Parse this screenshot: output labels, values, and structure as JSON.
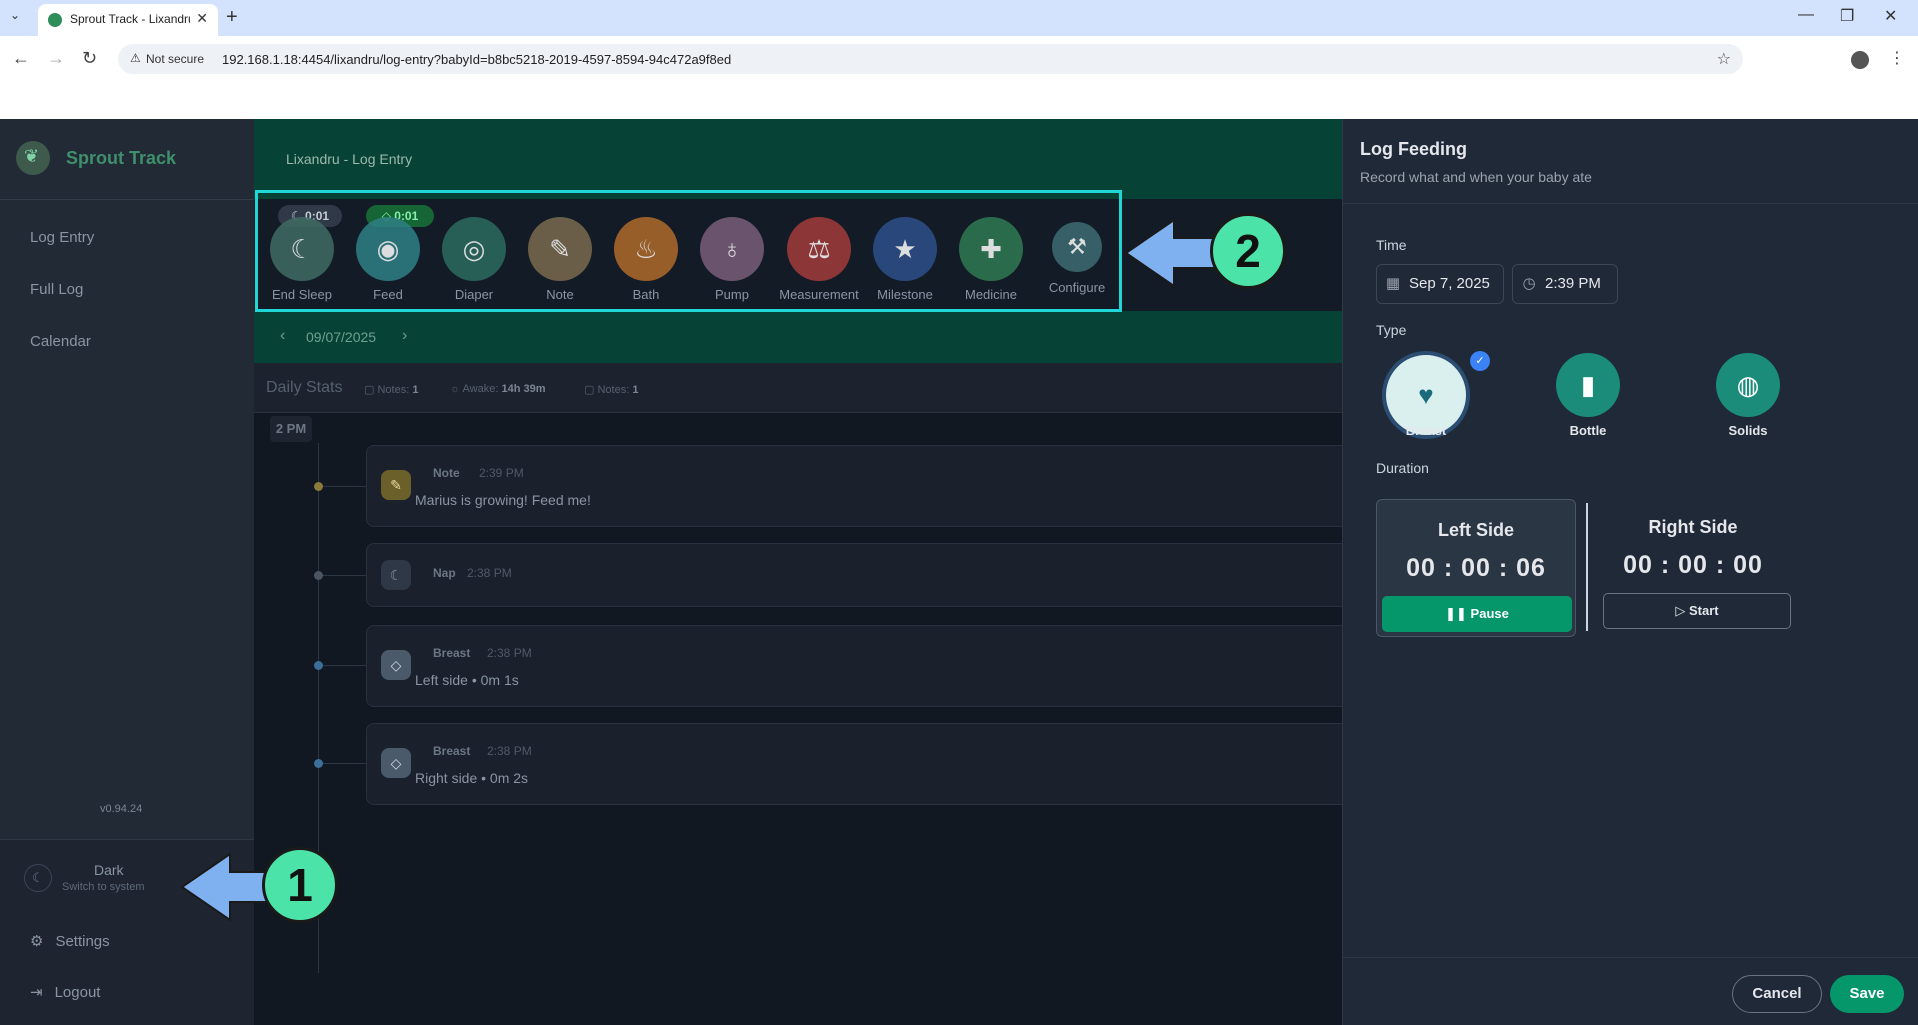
{
  "browser": {
    "tab_title": "Sprout Track - Lixandru",
    "not_secure": "Not secure",
    "url": "192.168.1.18:4454/lixandru/log-entry?babyId=b8bc5218-2019-4597-8594-94c472a9f8ed"
  },
  "sidebar": {
    "brand": "Sprout Track",
    "items": [
      {
        "label": "Log Entry"
      },
      {
        "label": "Full Log"
      },
      {
        "label": "Calendar"
      }
    ],
    "version": "v0.94.24",
    "theme_title": "Dark",
    "theme_sub": "Switch to system",
    "settings": "Settings",
    "logout": "Logout"
  },
  "main": {
    "breadcrumb": "Lixandru - Log Entry",
    "activities": [
      {
        "label": "End Sleep",
        "color": "#3f6b63"
      },
      {
        "label": "Feed",
        "color": "#2f7f86"
      },
      {
        "label": "Diaper",
        "color": "#2b6a5e"
      },
      {
        "label": "Note",
        "color": "#7a6a4f"
      },
      {
        "label": "Bath",
        "color": "#b06a2a"
      },
      {
        "label": "Pump",
        "color": "#7a5d7a"
      },
      {
        "label": "Measurement",
        "color": "#a33b3b"
      },
      {
        "label": "Milestone",
        "color": "#2d4f8a"
      },
      {
        "label": "Medicine",
        "color": "#2f7a52"
      },
      {
        "label": "Configure",
        "color": "#3d6b73"
      }
    ],
    "sleep_timer": "0:01",
    "feed_timer": "0:01",
    "date": "09/07/2025",
    "stats": {
      "title": "Daily Stats",
      "notes1": "Notes:",
      "notes1_val": "1",
      "awake": "Awake:",
      "awake_val": "14h 39m",
      "notes2": "Notes:",
      "notes2_val": "1"
    },
    "hour_label": "2 PM",
    "entries": [
      {
        "type": "Note",
        "time": "2:39 PM",
        "text": "Marius is growing! Feed me!"
      },
      {
        "type": "Nap",
        "time": "2:38 PM",
        "text": ""
      },
      {
        "type": "Breast",
        "time": "2:38 PM",
        "text": "Left side • 0m 1s"
      },
      {
        "type": "Breast",
        "time": "2:38 PM",
        "text": "Right side • 0m 2s"
      }
    ]
  },
  "panel": {
    "title": "Log Feeding",
    "subtitle": "Record what and when your baby ate",
    "time_label": "Time",
    "date_value": "Sep 7, 2025",
    "time_value": "2:39 PM",
    "type_label": "Type",
    "types": [
      {
        "label": "Breast"
      },
      {
        "label": "Bottle"
      },
      {
        "label": "Solids"
      }
    ],
    "duration_label": "Duration",
    "left_title": "Left Side",
    "left_timer": "00 : 00 : 06",
    "pause_label": "Pause",
    "right_title": "Right Side",
    "right_timer": "00 : 00 : 00",
    "start_label": "Start",
    "cancel": "Cancel",
    "save": "Save"
  },
  "callouts": {
    "one": "1",
    "two": "2"
  }
}
